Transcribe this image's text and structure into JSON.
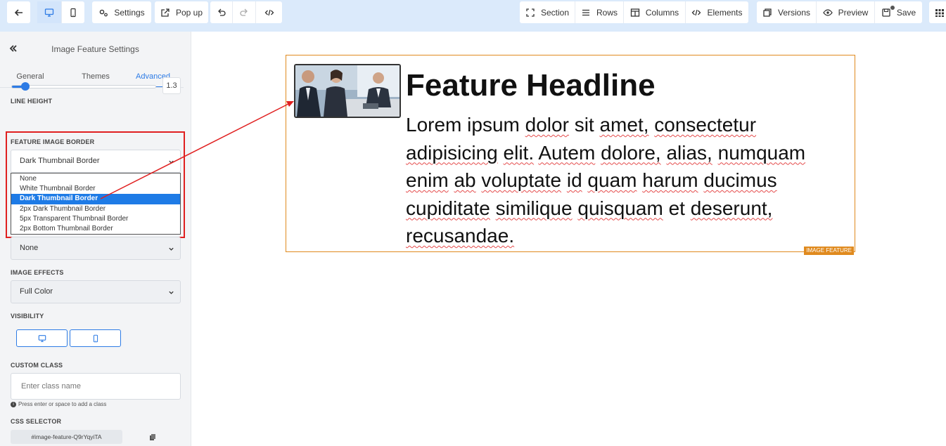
{
  "toolbar": {
    "settings": "Settings",
    "popup": "Pop up",
    "section": "Section",
    "rows": "Rows",
    "columns": "Columns",
    "elements": "Elements",
    "versions": "Versions",
    "preview": "Preview",
    "save": "Save"
  },
  "sidebar": {
    "title": "Image Feature Settings",
    "tabs": [
      "General",
      "Themes",
      "Advanced"
    ],
    "active_tab": "Advanced",
    "line_height": {
      "label": "LINE HEIGHT",
      "value": "1.3",
      "fraction": 0.12
    },
    "feature_image_border": {
      "label": "FEATURE IMAGE BORDER",
      "selected": "Dark Thumbnail Border",
      "options": [
        "None",
        "White Thumbnail Border",
        "Dark Thumbnail Border",
        "2px Dark Thumbnail Border",
        "5px Transparent Thumbnail Border",
        "2px Bottom Thumbnail Border"
      ]
    },
    "second_select": {
      "selected": "None"
    },
    "image_effects": {
      "label": "IMAGE EFFECTS",
      "selected": "Full Color"
    },
    "visibility": {
      "label": "VISIBILITY"
    },
    "custom_class": {
      "label": "CUSTOM CLASS",
      "placeholder": "Enter class name",
      "hint": "Press enter or space to add a class"
    },
    "css_selector": {
      "label": "CSS SELECTOR",
      "value": "#image-feature-Q9rYqyiTA"
    }
  },
  "canvas": {
    "headline": "Feature Headline",
    "body_words": [
      "Lorem",
      "ipsum",
      "dolor",
      "sit",
      "amet,",
      "consectetur",
      "adipisicing",
      "elit.",
      "Autem",
      "dolore,",
      "alias,",
      "numquam",
      "enim",
      "ab",
      "voluptate",
      "id",
      "quam",
      "harum",
      "ducimus",
      "cupiditate",
      "similique",
      "quisquam",
      "et",
      "deserunt,",
      "recusandae."
    ],
    "tag": "IMAGE FEATURE"
  },
  "colors": {
    "accent": "#2d7be5",
    "toolbar_bg": "#dbeafb",
    "annotation_red": "#e02020",
    "element_outline": "#e08a1e"
  }
}
